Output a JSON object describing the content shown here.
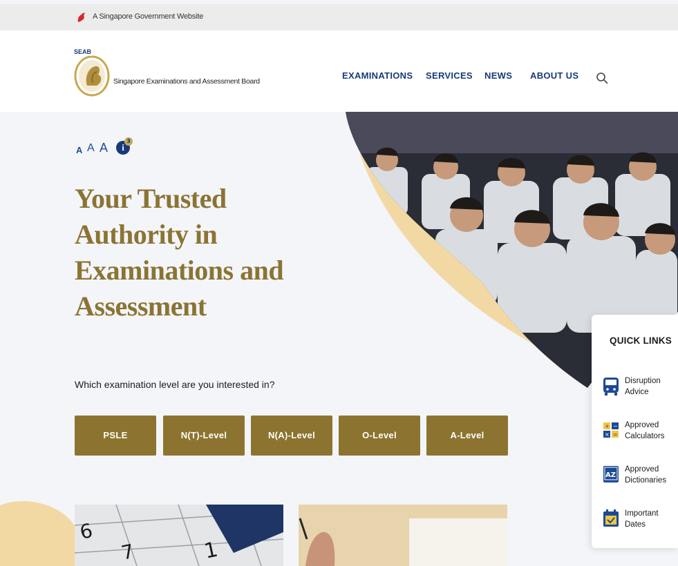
{
  "gov_bar": {
    "text": "A Singapore Government Website"
  },
  "header": {
    "logo_text": "SEAB",
    "brand": "Singapore Examinations and Assessment Board",
    "nav": [
      "EXAMINATIONS",
      "SERVICES",
      "NEWS",
      "ABOUT US"
    ],
    "search_icon": "search-icon"
  },
  "font_controls": {
    "small": "A",
    "medium": "A",
    "large": "A",
    "info": "i",
    "info_badge": "3"
  },
  "hero": {
    "title": "Your Trusted Authority in Examinations and Assessment",
    "question": "Which examination level are you interested in?",
    "levels": [
      "PSLE",
      "N(T)-Level",
      "N(A)-Level",
      "O-Level",
      "A-Level"
    ]
  },
  "quick_links": {
    "title": "QUICK LINKS",
    "items": [
      {
        "line1": "Disruption",
        "line2": "Advice",
        "icon": "bus-icon"
      },
      {
        "line1": "Approved",
        "line2": "Calculators",
        "icon": "calculator-icon"
      },
      {
        "line1": "Approved",
        "line2": "Dictionaries",
        "icon": "dictionary-icon"
      },
      {
        "line1": "Important",
        "line2": "Dates",
        "icon": "calendar-icon"
      }
    ]
  },
  "colors": {
    "brand_gold": "#8c7430",
    "title_gold": "#8b7433",
    "nav_blue": "#173a7a",
    "accent_cream": "#f2d9a4",
    "background": "#f4f5f9"
  }
}
